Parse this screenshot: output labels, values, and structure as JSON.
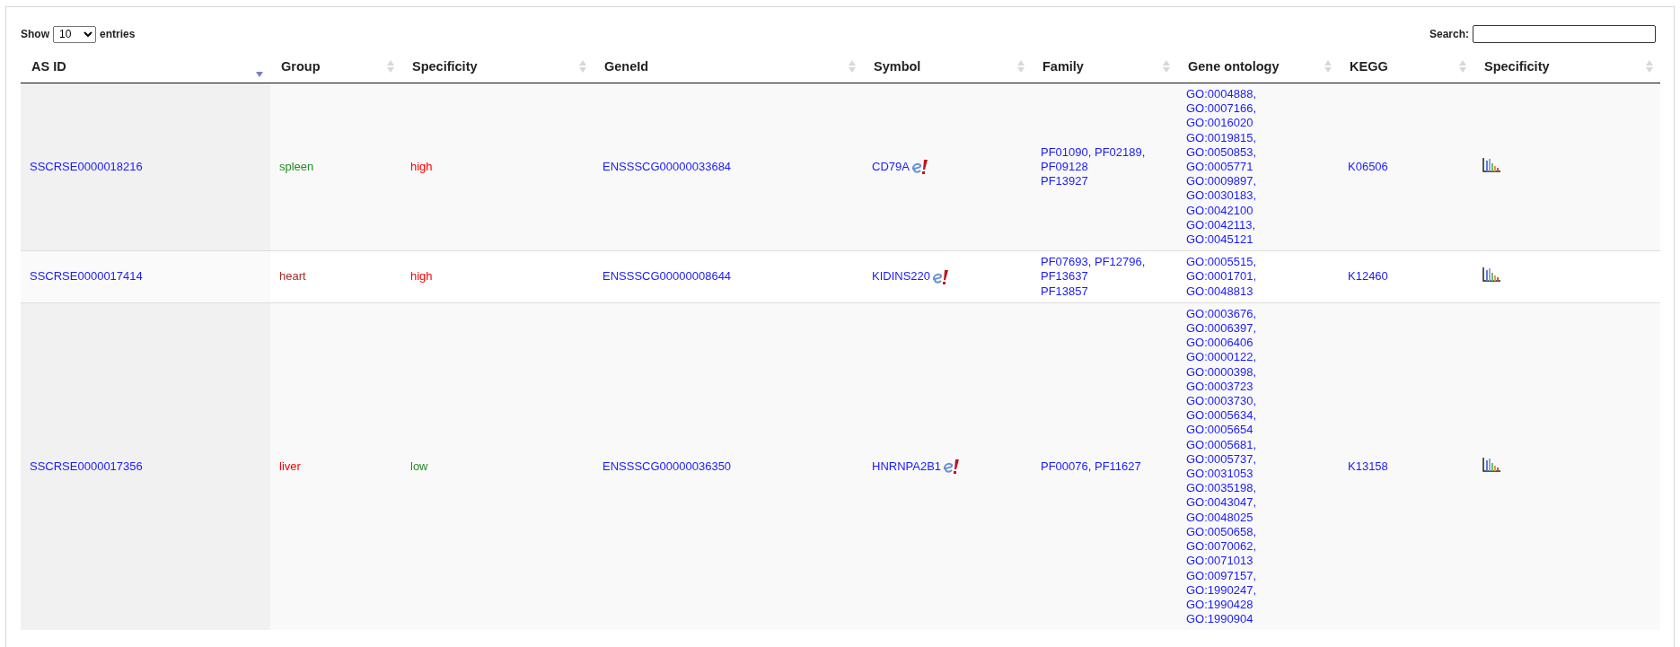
{
  "length_control": {
    "before": "Show",
    "value": "10",
    "after": "entries"
  },
  "search": {
    "label": "Search:"
  },
  "columns": [
    {
      "label": "AS ID",
      "sorted": true
    },
    {
      "label": "Group",
      "sorted": false
    },
    {
      "label": "Specificity",
      "sorted": false
    },
    {
      "label": "GeneId",
      "sorted": false
    },
    {
      "label": "Symbol",
      "sorted": false
    },
    {
      "label": "Family",
      "sorted": false
    },
    {
      "label": "Gene ontology",
      "sorted": false
    },
    {
      "label": "KEGG",
      "sorted": false
    },
    {
      "label": "Specificity",
      "sorted": false
    }
  ],
  "rows": [
    {
      "as_id": "SSCRSE0000018216",
      "group": {
        "text": "spleen",
        "color": "#228b22"
      },
      "specificity": {
        "text": "high",
        "color": "#ff0000"
      },
      "gene_id": "ENSSSCG00000033684",
      "symbol": "CD79A",
      "family": [
        "PF01090, PF02189,",
        "PF09128",
        "PF13927"
      ],
      "gene_ontology": [
        "GO:0004888,",
        "GO:0007166,",
        "GO:0016020",
        "GO:0019815,",
        "GO:0050853,",
        "GO:0005771",
        "GO:0009897,",
        "GO:0030183,",
        "GO:0042100",
        "GO:0042113,",
        "GO:0045121"
      ],
      "kegg": "K06506"
    },
    {
      "as_id": "SSCRSE0000017414",
      "group": {
        "text": "heart",
        "color": "#a52a2a"
      },
      "specificity": {
        "text": "high",
        "color": "#ff0000"
      },
      "gene_id": "ENSSSCG00000008644",
      "symbol": "KIDINS220",
      "family": [
        "PF07693, PF12796,",
        "PF13637",
        "PF13857"
      ],
      "gene_ontology": [
        "GO:0005515,",
        "GO:0001701,",
        "GO:0048813"
      ],
      "kegg": "K12460"
    },
    {
      "as_id": "SSCRSE0000017356",
      "group": {
        "text": "liver",
        "color": "#ff0000"
      },
      "specificity": {
        "text": "low",
        "color": "#228b22"
      },
      "gene_id": "ENSSSCG00000036350",
      "symbol": "HNRNPA2B1",
      "family": [
        "PF00076, PF11627"
      ],
      "gene_ontology": [
        "GO:0003676,",
        "GO:0006397,",
        "GO:0006406",
        "GO:0000122,",
        "GO:0000398,",
        "GO:0003723",
        "GO:0003730,",
        "GO:0005634,",
        "GO:0005654",
        "GO:0005681,",
        "GO:0005737,",
        "GO:0031053",
        "GO:0035198,",
        "GO:0043047,",
        "GO:0048025",
        "GO:0050658,",
        "GO:0070062,",
        "GO:0071013",
        "GO:0097157,",
        "GO:1990247,",
        "GO:1990428",
        "GO:1990904"
      ],
      "kegg": "K13158"
    }
  ]
}
